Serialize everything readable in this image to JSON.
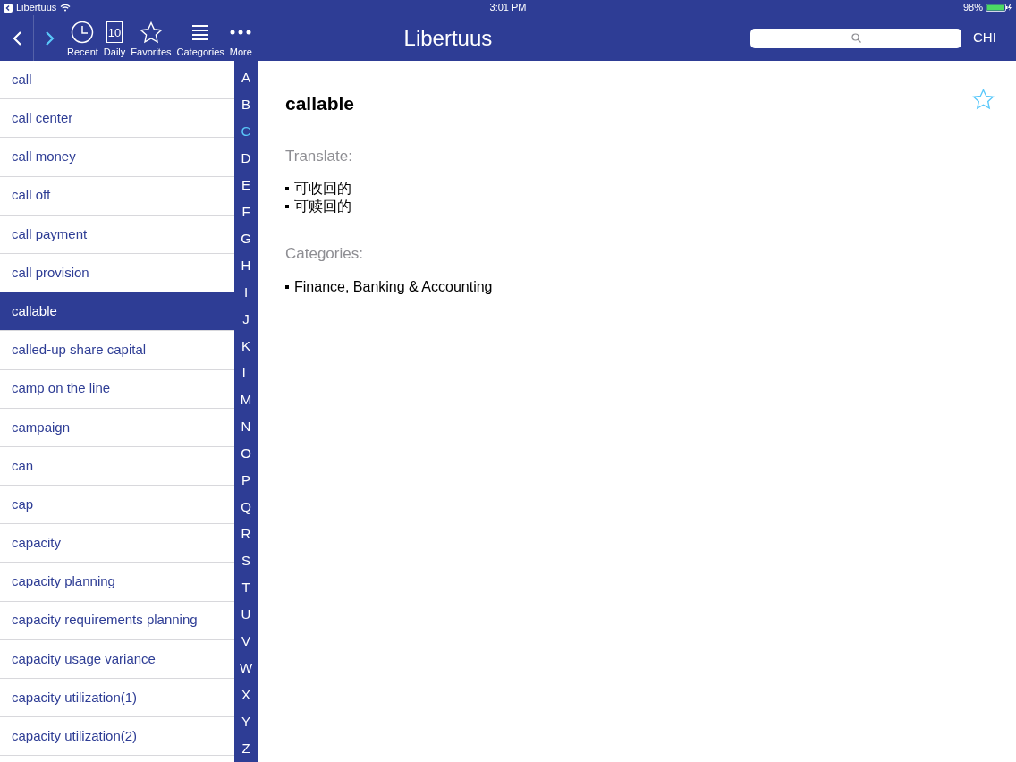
{
  "status_bar": {
    "back_app": "Libertuus",
    "time": "3:01 PM",
    "battery": "98%"
  },
  "toolbar": {
    "back_enabled": false,
    "forward_enabled": true,
    "buttons": [
      {
        "kind": "clock",
        "label": "Recent"
      },
      {
        "kind": "calendar",
        "label": "Daily",
        "icon_text": "10"
      },
      {
        "kind": "star",
        "label": "Favorites"
      },
      {
        "kind": "lines",
        "label": "Categories"
      },
      {
        "kind": "dots",
        "label": "More"
      }
    ],
    "title": "Libertuus",
    "language": "CHI"
  },
  "terms": [
    {
      "label": "call",
      "selected": false
    },
    {
      "label": "call center",
      "selected": false
    },
    {
      "label": "call money",
      "selected": false
    },
    {
      "label": "call off",
      "selected": false
    },
    {
      "label": "call payment",
      "selected": false
    },
    {
      "label": "call provision",
      "selected": false
    },
    {
      "label": "callable",
      "selected": true
    },
    {
      "label": "called-up share capital",
      "selected": false
    },
    {
      "label": "camp on the line",
      "selected": false
    },
    {
      "label": "campaign",
      "selected": false
    },
    {
      "label": "can",
      "selected": false
    },
    {
      "label": "cap",
      "selected": false
    },
    {
      "label": "capacity",
      "selected": false
    },
    {
      "label": "capacity planning",
      "selected": false
    },
    {
      "label": "capacity requirements planning",
      "selected": false
    },
    {
      "label": "capacity usage variance",
      "selected": false
    },
    {
      "label": "capacity utilization(1)",
      "selected": false
    },
    {
      "label": "capacity utilization(2)",
      "selected": false
    }
  ],
  "alphabet": [
    {
      "letter": "A",
      "selected": false
    },
    {
      "letter": "B",
      "selected": false
    },
    {
      "letter": "C",
      "selected": true
    },
    {
      "letter": "D",
      "selected": false
    },
    {
      "letter": "E",
      "selected": false
    },
    {
      "letter": "F",
      "selected": false
    },
    {
      "letter": "G",
      "selected": false
    },
    {
      "letter": "H",
      "selected": false
    },
    {
      "letter": "I",
      "selected": false
    },
    {
      "letter": "J",
      "selected": false
    },
    {
      "letter": "K",
      "selected": false
    },
    {
      "letter": "L",
      "selected": false
    },
    {
      "letter": "M",
      "selected": false
    },
    {
      "letter": "N",
      "selected": false
    },
    {
      "letter": "O",
      "selected": false
    },
    {
      "letter": "P",
      "selected": false
    },
    {
      "letter": "Q",
      "selected": false
    },
    {
      "letter": "R",
      "selected": false
    },
    {
      "letter": "S",
      "selected": false
    },
    {
      "letter": "T",
      "selected": false
    },
    {
      "letter": "U",
      "selected": false
    },
    {
      "letter": "V",
      "selected": false
    },
    {
      "letter": "W",
      "selected": false
    },
    {
      "letter": "X",
      "selected": false
    },
    {
      "letter": "Y",
      "selected": false
    },
    {
      "letter": "Z",
      "selected": false
    }
  ],
  "detail": {
    "term": "callable",
    "favorite": false,
    "sections": [
      {
        "heading": "Translate:",
        "items": [
          "可收回的",
          "可赎回的"
        ]
      },
      {
        "heading": "Categories:",
        "items": [
          "Finance, Banking & Accounting"
        ]
      }
    ]
  }
}
